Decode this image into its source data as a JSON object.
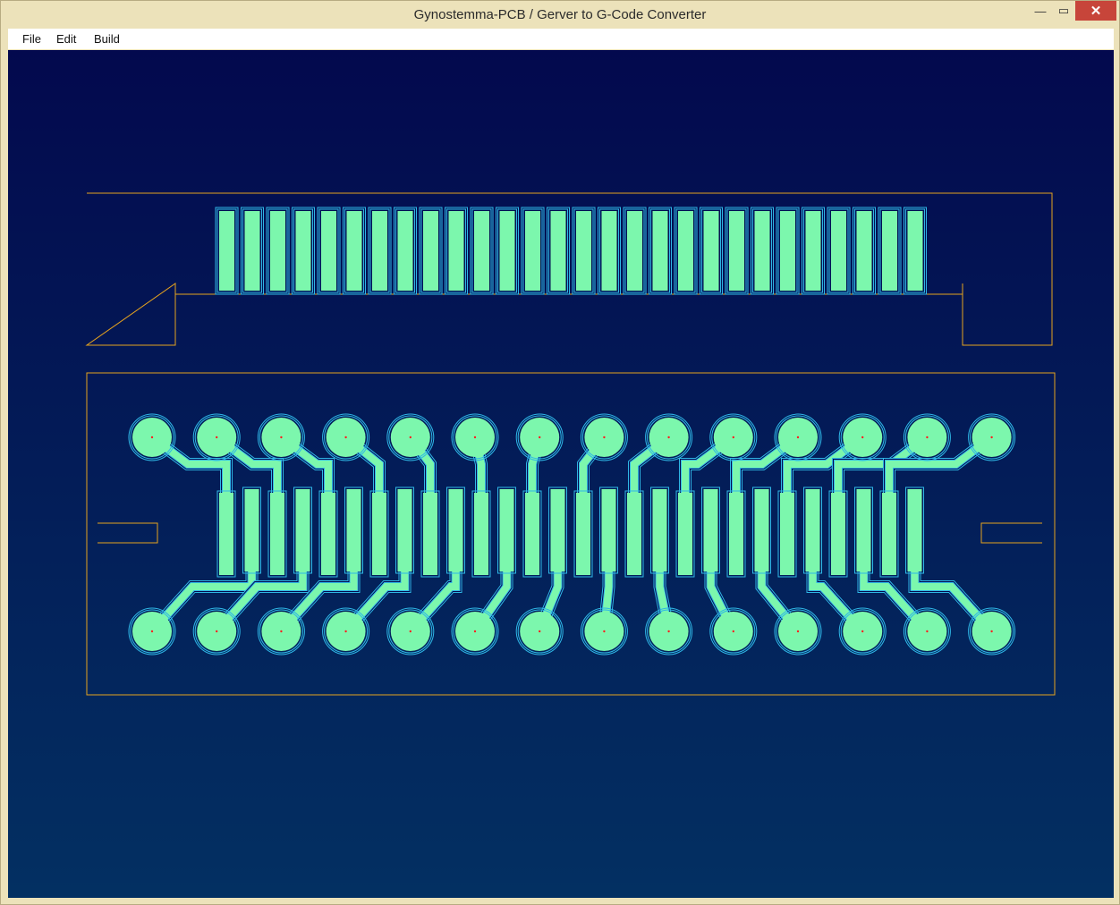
{
  "window": {
    "title": "Gynostemma-PCB / Gerver to G-Code Converter",
    "controls": {
      "minimize": "—",
      "maximize": "▭",
      "close": "✕"
    }
  },
  "menu": {
    "items": [
      {
        "id": "file",
        "label": "File"
      },
      {
        "id": "edit",
        "label": "Edit"
      },
      {
        "id": "build",
        "label": "Build"
      }
    ]
  },
  "colors": {
    "copper_fill": "#7cf7ad",
    "toolpath": "#2fb7e6",
    "outline": "#e6a31e",
    "drill_mark": "#ff2020",
    "canvas_top": "#03094e",
    "canvas_bottom": "#033062"
  },
  "pcb": {
    "top_pad_count": 28,
    "bottom_pin_count": 14,
    "middle_pad_count": 28
  }
}
